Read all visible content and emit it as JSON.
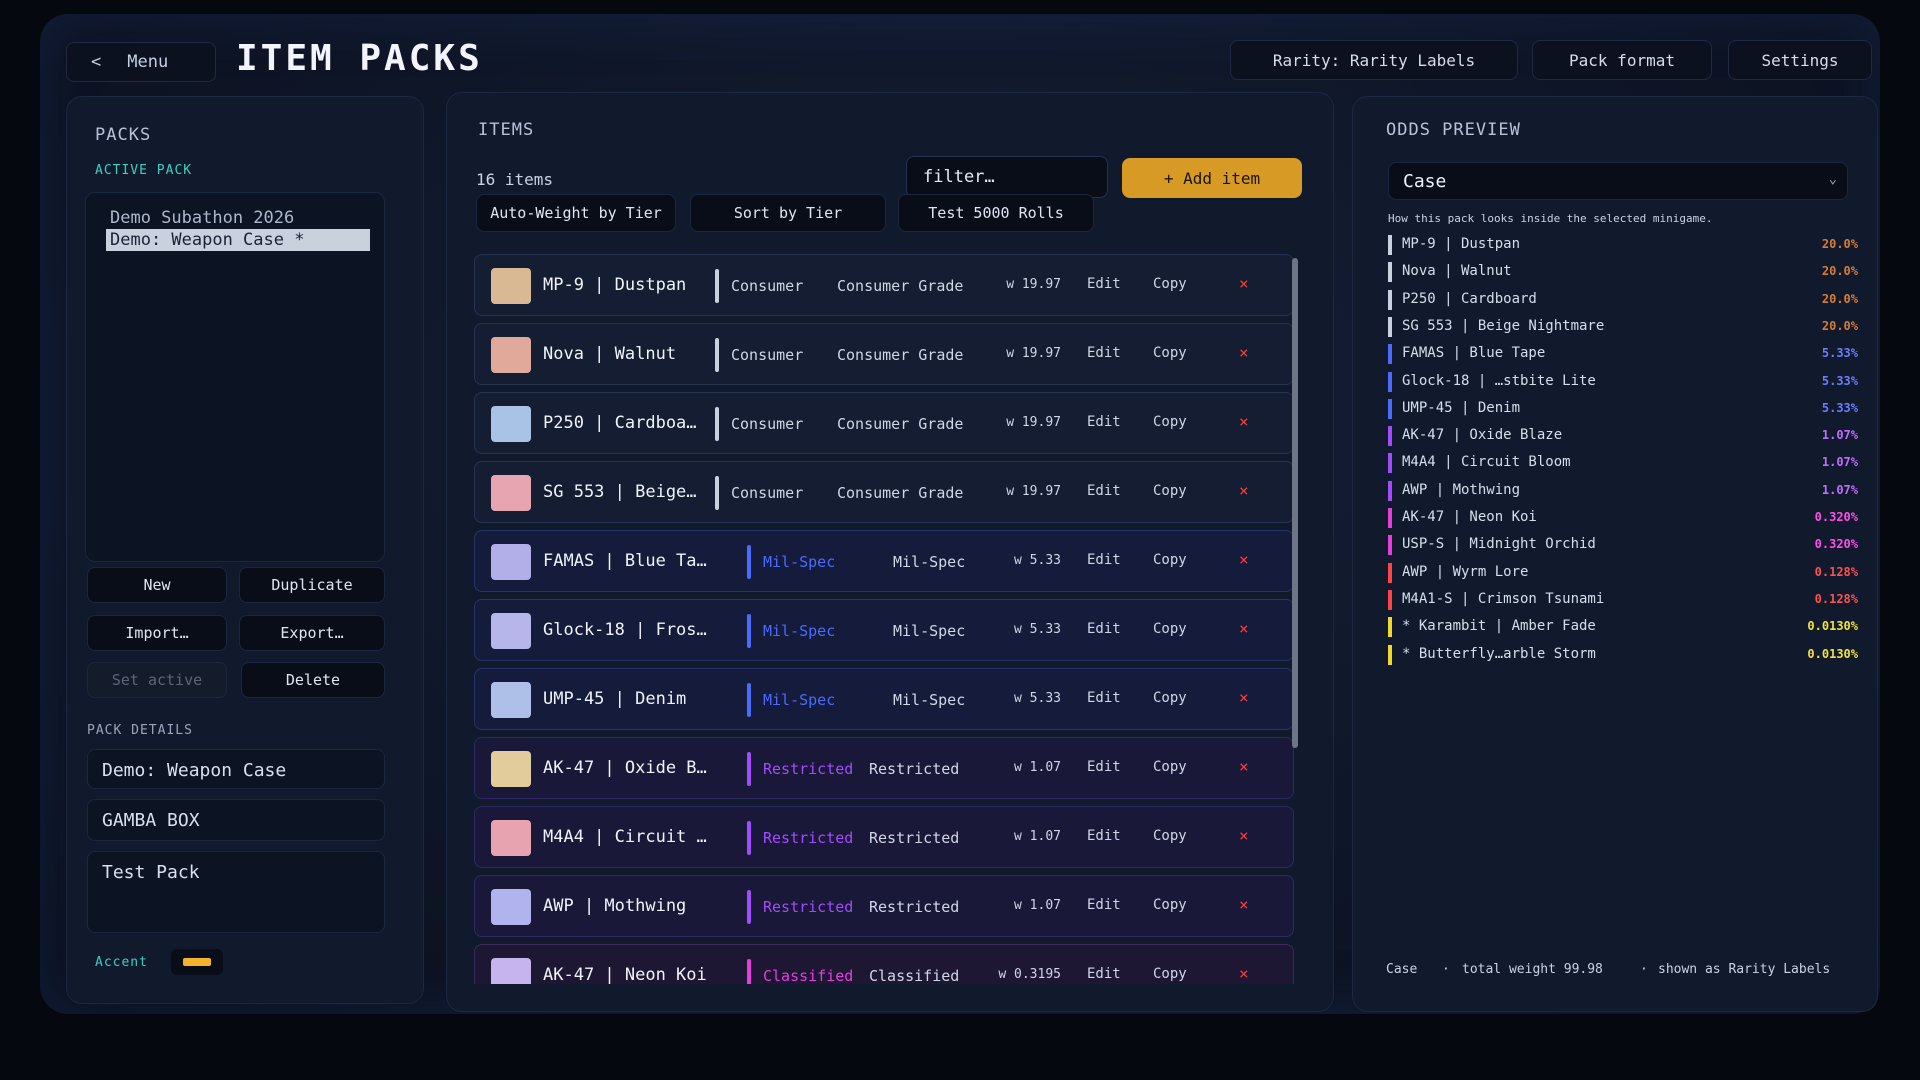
{
  "header": {
    "menu_label": "Menu",
    "title": "ITEM PACKS",
    "rarity_button": "Rarity: Rarity Labels",
    "pack_format_button": "Pack format",
    "settings_button": "Settings"
  },
  "packs_panel": {
    "title": "PACKS",
    "active_pack_label": "ACTIVE PACK",
    "packs": [
      "Demo Subathon 2026",
      "Demo: Weapon Case  *"
    ],
    "buttons": {
      "new": "New",
      "duplicate": "Duplicate",
      "import": "Import…",
      "export": "Export…",
      "set_active": "Set active",
      "delete": "Delete"
    },
    "details_label": "PACK DETAILS",
    "details": {
      "pack_name": "Demo: Weapon Case",
      "box_name": "GAMBA BOX",
      "description": "Test Pack"
    },
    "accent_label": "Accent",
    "accent_color": "#f4b32a"
  },
  "items_panel": {
    "title": "ITEMS",
    "count_label": "16 items",
    "filter_placeholder": "filter…",
    "add_label": "+ Add item",
    "toolbar": {
      "auto_weight": "Auto-Weight by Tier",
      "sort": "Sort by Tier",
      "test": "Test 5000 Rolls"
    },
    "action_labels": {
      "edit": "Edit",
      "copy": "Copy",
      "delete": "×"
    },
    "items": [
      {
        "name": "MP-9 | Dustpan",
        "tier": "Consumer",
        "grade": "Consumer Grade",
        "weight": "w 19.97",
        "thumb": "#d9b894",
        "tier_color": "#c9d0de",
        "row_class": "tier-consumer"
      },
      {
        "name": "Nova | Walnut",
        "tier": "Consumer",
        "grade": "Consumer Grade",
        "weight": "w 19.97",
        "thumb": "#e0a99a",
        "tier_color": "#c9d0de",
        "row_class": "tier-consumer"
      },
      {
        "name": "P250 | Cardboa…",
        "tier": "Consumer",
        "grade": "Consumer Grade",
        "weight": "w 19.97",
        "thumb": "#a9c3e6",
        "tier_color": "#c9d0de",
        "row_class": "tier-consumer"
      },
      {
        "name": "SG 553 | Beige…",
        "tier": "Consumer",
        "grade": "Consumer Grade",
        "weight": "w 19.97",
        "thumb": "#e6a5b1",
        "tier_color": "#c9d0de",
        "row_class": "tier-consumer"
      },
      {
        "name": "FAMAS | Blue Tape",
        "tier": "Mil-Spec",
        "grade": "Mil-Spec",
        "weight": "w 5.33",
        "thumb": "#b2afe8",
        "tier_color": "#4b6bff",
        "row_class": "tier-milspec"
      },
      {
        "name": "Glock-18 | Frostb…",
        "tier": "Mil-Spec",
        "grade": "Mil-Spec",
        "weight": "w 5.33",
        "thumb": "#b7b6ea",
        "tier_color": "#4b6bff",
        "row_class": "tier-milspec"
      },
      {
        "name": "UMP-45 | Denim",
        "tier": "Mil-Spec",
        "grade": "Mil-Spec",
        "weight": "w 5.33",
        "thumb": "#aebfe8",
        "tier_color": "#4b6bff",
        "row_class": "tier-milspec"
      },
      {
        "name": "AK-47 | Oxide Bla…",
        "tier": "Restricted",
        "grade": "Restricted",
        "weight": "w 1.07",
        "thumb": "#e3cc9c",
        "tier_color": "#a24bff",
        "row_class": "tier-restricted"
      },
      {
        "name": "M4A4 | Circuit Bl…",
        "tier": "Restricted",
        "grade": "Restricted",
        "weight": "w 1.07",
        "thumb": "#e8a3b0",
        "tier_color": "#a24bff",
        "row_class": "tier-restricted"
      },
      {
        "name": "AWP | Mothwing",
        "tier": "Restricted",
        "grade": "Restricted",
        "weight": "w 1.07",
        "thumb": "#b1b3ee",
        "tier_color": "#a24bff",
        "row_class": "tier-restricted"
      },
      {
        "name": "AK-47 | Neon Koi",
        "tier": "Classified",
        "grade": "Classified",
        "weight": "w 0.3195",
        "thumb": "#c6b4ee",
        "tier_color": "#e63ce0",
        "row_class": "tier-classified"
      }
    ]
  },
  "odds_panel": {
    "title": "ODDS PREVIEW",
    "selected_minigame": "Case",
    "hint": "How this pack looks inside the selected minigame.",
    "rows": [
      {
        "name": "MP-9 | Dustpan",
        "pct": "20.0%",
        "color": "#c9d0de",
        "pct_color": "#d67b3a"
      },
      {
        "name": "Nova | Walnut",
        "pct": "20.0%",
        "color": "#c9d0de",
        "pct_color": "#d67b3a"
      },
      {
        "name": "P250 | Cardboard",
        "pct": "20.0%",
        "color": "#c9d0de",
        "pct_color": "#d67b3a"
      },
      {
        "name": "SG 553 | Beige Nightmare",
        "pct": "20.0%",
        "color": "#c9d0de",
        "pct_color": "#d67b3a"
      },
      {
        "name": "FAMAS | Blue Tape",
        "pct": "5.33%",
        "color": "#4b6bff",
        "pct_color": "#6a7dff"
      },
      {
        "name": "Glock-18 | …stbite Lite",
        "pct": "5.33%",
        "color": "#4b6bff",
        "pct_color": "#6a7dff"
      },
      {
        "name": "UMP-45 | Denim",
        "pct": "5.33%",
        "color": "#4b6bff",
        "pct_color": "#6a7dff"
      },
      {
        "name": "AK-47 | Oxide Blaze",
        "pct": "1.07%",
        "color": "#a24bff",
        "pct_color": "#c26cff"
      },
      {
        "name": "M4A4 | Circuit Bloom",
        "pct": "1.07%",
        "color": "#a24bff",
        "pct_color": "#c26cff"
      },
      {
        "name": "AWP | Mothwing",
        "pct": "1.07%",
        "color": "#a24bff",
        "pct_color": "#c26cff"
      },
      {
        "name": "AK-47 | Neon Koi",
        "pct": "0.320%",
        "color": "#e63ce0",
        "pct_color": "#ff4fe6"
      },
      {
        "name": "USP-S | Midnight Orchid",
        "pct": "0.320%",
        "color": "#e63ce0",
        "pct_color": "#ff4fe6"
      },
      {
        "name": "AWP | Wyrm Lore",
        "pct": "0.128%",
        "color": "#ff4545",
        "pct_color": "#ff5050"
      },
      {
        "name": "M4A1-S | Crimson Tsunami",
        "pct": "0.128%",
        "color": "#ff4545",
        "pct_color": "#ff5050"
      },
      {
        "name": "* Karambit | Amber Fade",
        "pct": "0.0130%",
        "color": "#f2d82a",
        "pct_color": "#f2e23a"
      },
      {
        "name": "* Butterfly…arble Storm",
        "pct": "0.0130%",
        "color": "#f2d82a",
        "pct_color": "#f2e23a"
      }
    ],
    "footer": {
      "minigame": "Case",
      "sep1": "·",
      "total": "total weight 99.98",
      "sep2": "·",
      "shown_as": "shown as Rarity Labels"
    }
  }
}
